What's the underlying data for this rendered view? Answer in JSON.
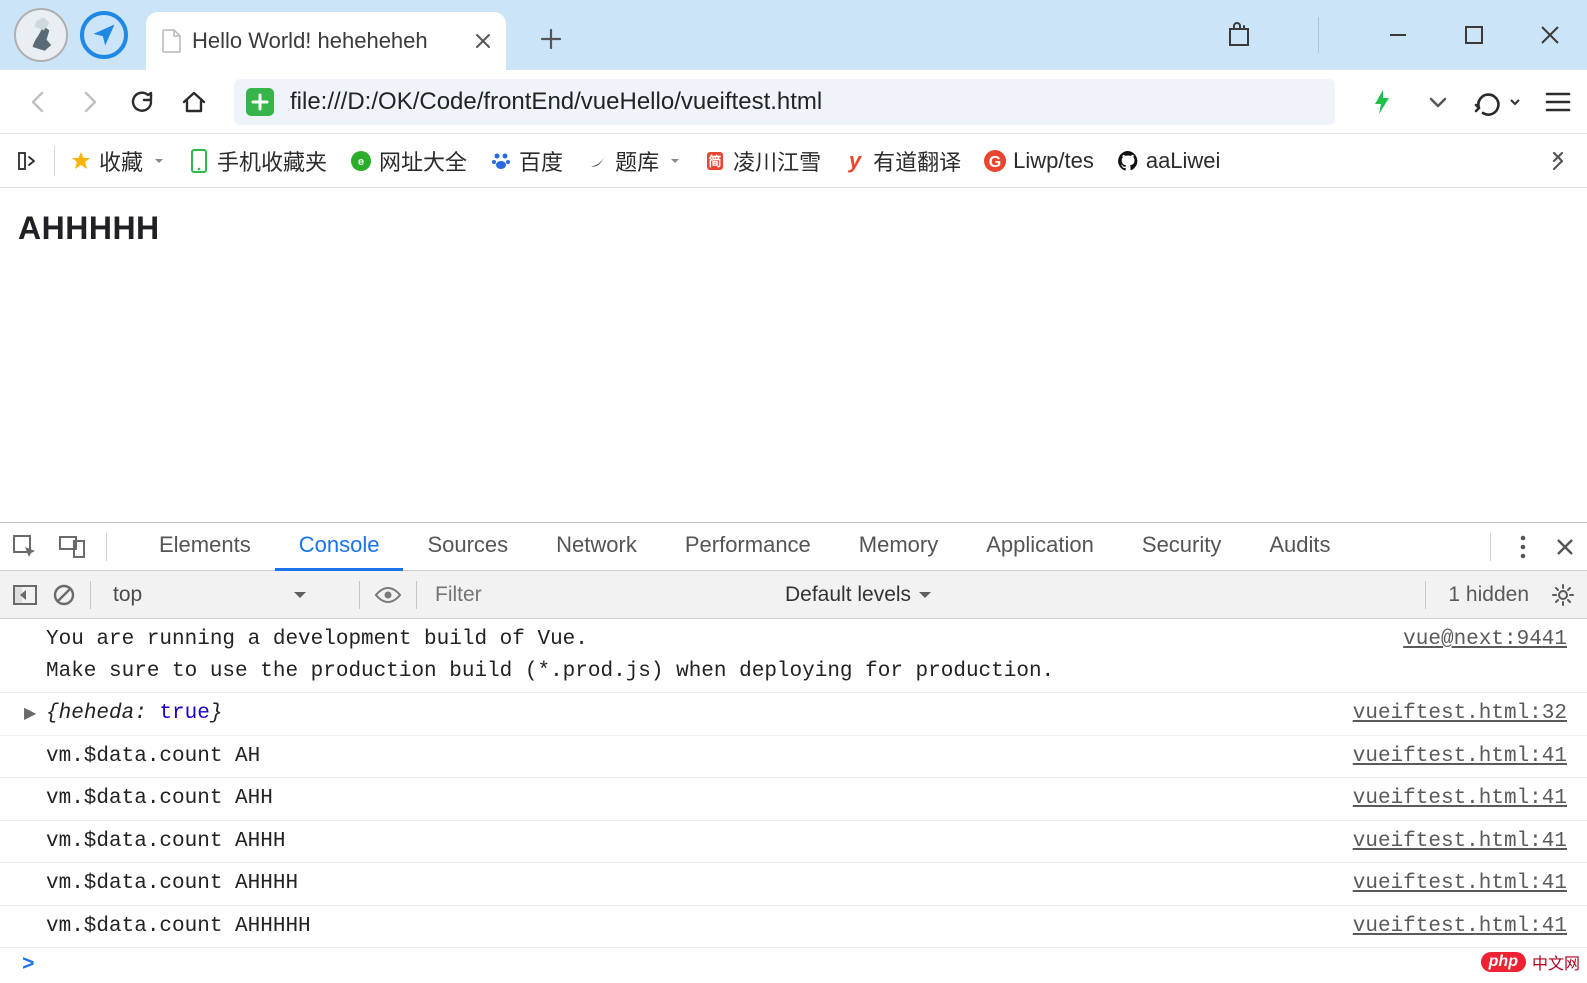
{
  "tab": {
    "title": "Hello World! heheheheh"
  },
  "url": "file:///D:/OK/Code/frontEnd/vueHello/vueiftest.html",
  "bookmarks": [
    {
      "label": "收藏",
      "icon": "star",
      "color": "#ffb300",
      "dd": true
    },
    {
      "label": "手机收藏夹",
      "icon": "phone",
      "color": "#2dbb4e"
    },
    {
      "label": "网址大全",
      "icon": "threesixty",
      "color": "#2aae2a"
    },
    {
      "label": "百度",
      "icon": "paw",
      "color": "#2a6ae0"
    },
    {
      "label": "题库",
      "icon": "swoosh",
      "color": "#111",
      "dd": true
    },
    {
      "label": "凌川江雪",
      "icon": "book",
      "color": "#e8462f"
    },
    {
      "label": "有道翻译",
      "icon": "y",
      "color": "#e8462f"
    },
    {
      "label": "Liwp/tes",
      "icon": "g",
      "color": "#e8462f"
    },
    {
      "label": "aaLiwei",
      "icon": "github",
      "color": "#111"
    }
  ],
  "page": {
    "heading": "AHHHHH"
  },
  "devtools": {
    "tabs": [
      "Elements",
      "Console",
      "Sources",
      "Network",
      "Performance",
      "Memory",
      "Application",
      "Security",
      "Audits"
    ],
    "active": "Console",
    "context": "top",
    "filter_placeholder": "Filter",
    "levels_label": "Default levels",
    "hidden_label": "1 hidden"
  },
  "console": {
    "banner": {
      "lines": [
        "You are running a development build of Vue.",
        "Make sure to use the production build (*.prod.js) when deploying for production."
      ],
      "src": "vue@next:9441"
    },
    "obj_row": {
      "key": "heheda",
      "val": "true",
      "src": "vueiftest.html:32"
    },
    "rows": [
      {
        "msg": "vm.$data.count AH",
        "src": "vueiftest.html:41"
      },
      {
        "msg": "vm.$data.count AHH",
        "src": "vueiftest.html:41"
      },
      {
        "msg": "vm.$data.count AHHH",
        "src": "vueiftest.html:41"
      },
      {
        "msg": "vm.$data.count AHHHH",
        "src": "vueiftest.html:41"
      },
      {
        "msg": "vm.$data.count AHHHHH",
        "src": "vueiftest.html:41"
      }
    ]
  },
  "watermark": {
    "badge": "php",
    "text": "中文网"
  }
}
